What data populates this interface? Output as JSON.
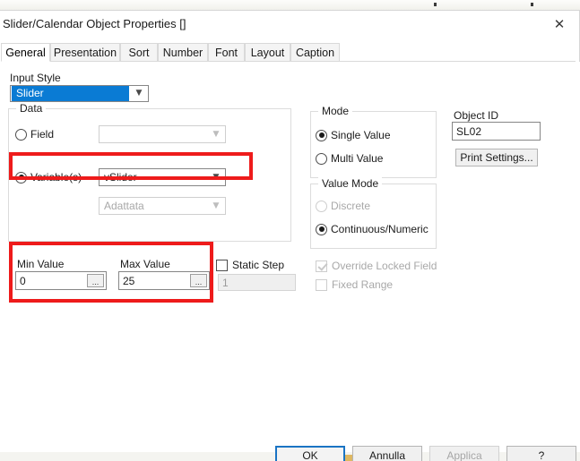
{
  "window": {
    "title": "Slider/Calendar Object Properties []",
    "close_icon": "close-icon"
  },
  "tabs": [
    {
      "label": "General",
      "active": true
    },
    {
      "label": "Presentation",
      "active": false
    },
    {
      "label": "Sort",
      "active": false
    },
    {
      "label": "Number",
      "active": false
    },
    {
      "label": "Font",
      "active": false
    },
    {
      "label": "Layout",
      "active": false
    },
    {
      "label": "Caption",
      "active": false
    }
  ],
  "input_style": {
    "label": "Input Style",
    "value": "Slider",
    "arrow_icon": "chevron-down-icon"
  },
  "data_group": {
    "title": "Data",
    "field": {
      "label": "Field",
      "selected": false,
      "value": "",
      "arrow_icon": "chevron-down-icon"
    },
    "variables": {
      "label": "Variable(s)",
      "selected": true,
      "value": "vSlider",
      "arrow_icon": "chevron-down-icon"
    },
    "secondary_combo": {
      "value": "Adattata",
      "enabled": false,
      "arrow_icon": "chevron-down-icon"
    }
  },
  "range": {
    "min_label": "Min Value",
    "min_value": "0",
    "max_label": "Max Value",
    "max_value": "25",
    "ellipsis_label": "...",
    "static_step": {
      "label": "Static Step",
      "checked": false,
      "value": "1",
      "value_enabled": false
    }
  },
  "mode_group": {
    "title": "Mode",
    "options": [
      {
        "label": "Single Value",
        "selected": true,
        "enabled": true
      },
      {
        "label": "Multi Value",
        "selected": false,
        "enabled": true
      }
    ]
  },
  "value_mode_group": {
    "title": "Value Mode",
    "options": [
      {
        "label": "Discrete",
        "selected": false,
        "enabled": false
      },
      {
        "label": "Continuous/Numeric",
        "selected": true,
        "enabled": true
      }
    ]
  },
  "locked_options": [
    {
      "label": "Override Locked Field",
      "checked": true,
      "enabled": false
    },
    {
      "label": "Fixed Range",
      "checked": false,
      "enabled": false
    }
  ],
  "object_id": {
    "label": "Object ID",
    "value": "SL02",
    "print_settings_label": "Print Settings..."
  },
  "footer": {
    "ok_label": "OK",
    "cancel_label": "Annulla",
    "apply_label": "Applica",
    "apply_enabled": false,
    "help_label": "?"
  },
  "colors": {
    "accent": "#0a7bd4",
    "annotation": "#ee1b1b",
    "default_button_border": "#1a74c4",
    "desktop_line": "#938a34"
  }
}
